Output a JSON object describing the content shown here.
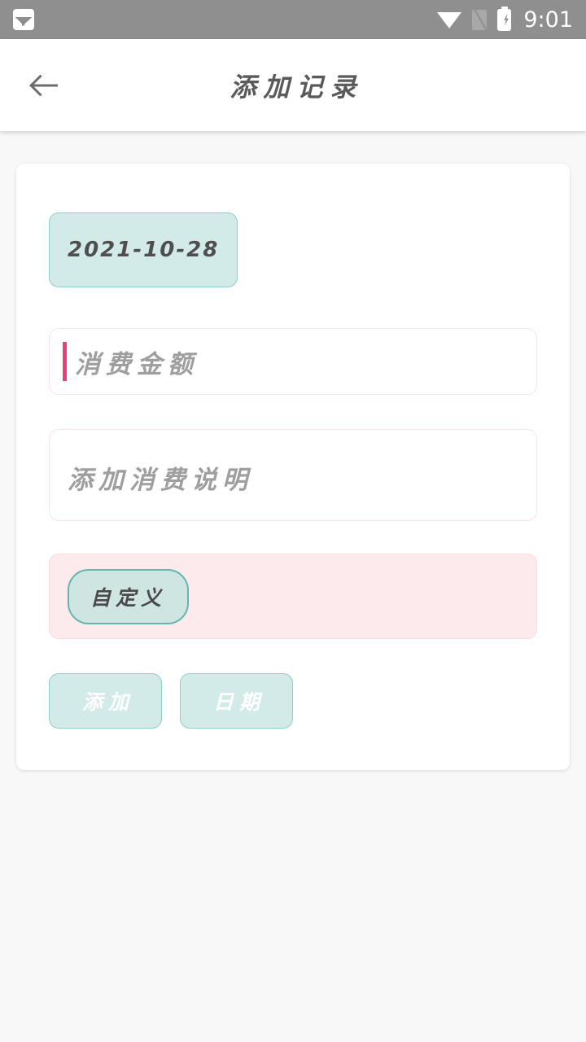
{
  "status_bar": {
    "background": "#8f8f8f",
    "notification_icon": "photo-icon",
    "wifi_icon": "wifi-icon",
    "sim_icon": "no-sim-icon",
    "battery_icon": "battery-charging-icon",
    "time": "9:01"
  },
  "app_bar": {
    "back_icon": "arrow-left-icon",
    "title": "添加记录"
  },
  "form": {
    "date_chip": {
      "value": "2021-10-28",
      "background": "#d2ebe8",
      "border": "#8fcfc9"
    },
    "amount_field": {
      "value": "",
      "placeholder": "消费金额",
      "caret_color": "#ec3f72",
      "border": "#fbe2e6"
    },
    "note_field": {
      "value": "",
      "placeholder": "添加消费说明",
      "border": "#fbe2e6"
    },
    "category_panel": {
      "background": "#fceaec",
      "tags": [
        {
          "label": "自定义",
          "selected": true
        }
      ]
    },
    "buttons": [
      {
        "label": "添加",
        "name": "add-button"
      },
      {
        "label": "日期",
        "name": "date-button"
      }
    ]
  }
}
